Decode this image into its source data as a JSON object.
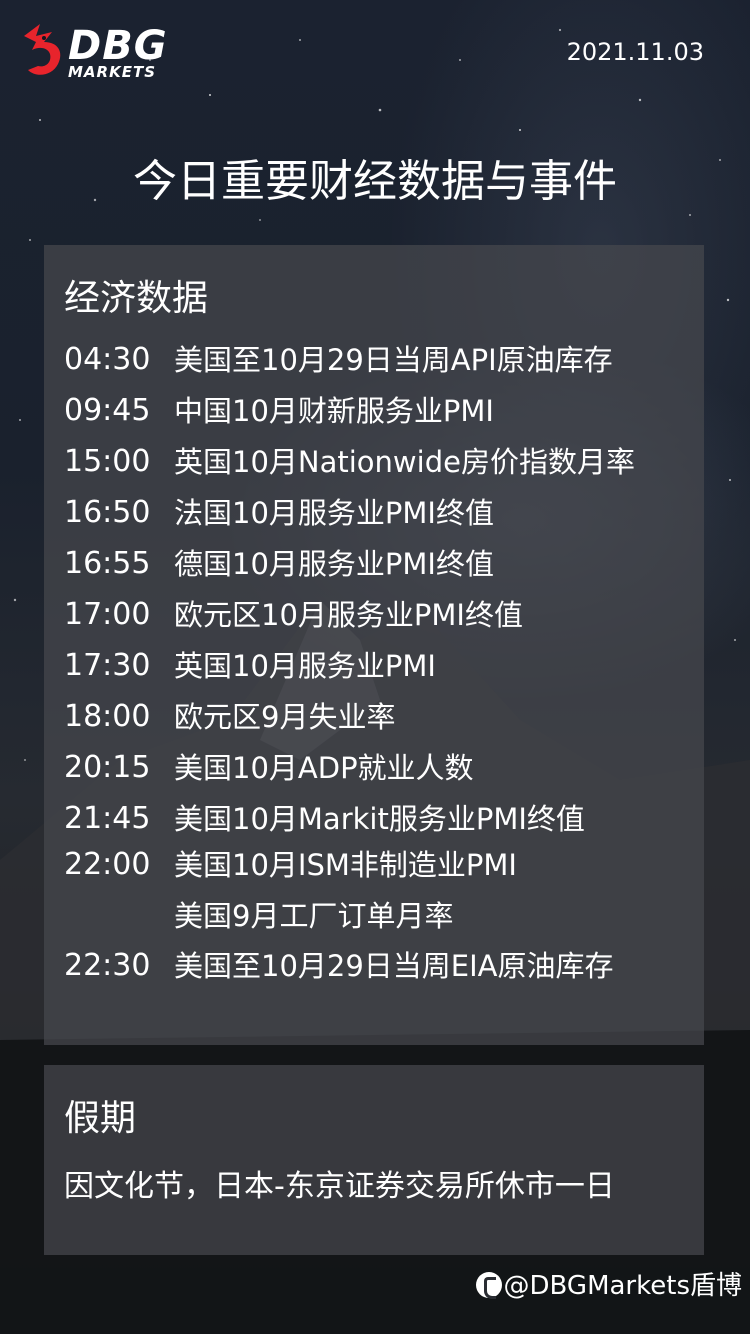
{
  "header": {
    "logo_main": "DBG",
    "logo_sub": "MARKETS",
    "date": "2021.11.03"
  },
  "title": "今日重要财经数据与事件",
  "economic_data": {
    "heading": "经济数据",
    "items": [
      {
        "time": "04:30",
        "event": "美国至10月29日当周API原油库存"
      },
      {
        "time": "09:45",
        "event": "中国10月财新服务业PMI"
      },
      {
        "time": "15:00",
        "event": "英国10月Nationwide房价指数月率"
      },
      {
        "time": "16:50",
        "event": "法国10月服务业PMI终值"
      },
      {
        "time": "16:55",
        "event": "德国10月服务业PMI终值"
      },
      {
        "time": "17:00",
        "event": "欧元区10月服务业PMI终值"
      },
      {
        "time": "17:30",
        "event": "英国10月服务业PMI"
      },
      {
        "time": "18:00",
        "event": "欧元区9月失业率"
      },
      {
        "time": "20:15",
        "event": "美国10月ADP就业人数"
      },
      {
        "time": "21:45",
        "event": "美国10月Markit服务业PMI终值"
      },
      {
        "time": "22:00",
        "event": "美国10月ISM非制造业PMI"
      },
      {
        "time": "",
        "event": "美国9月工厂订单月率"
      },
      {
        "time": "22:30",
        "event": "美国至10月29日当周EIA原油库存"
      }
    ]
  },
  "holiday": {
    "heading": "假期",
    "text": "因文化节，日本-东京证券交易所休市一日"
  },
  "footer": {
    "weibo_handle": "@DBGMarkets盾博"
  },
  "colors": {
    "logo_red": "#e8242c",
    "panel": "#46484e",
    "text": "#ffffff"
  }
}
